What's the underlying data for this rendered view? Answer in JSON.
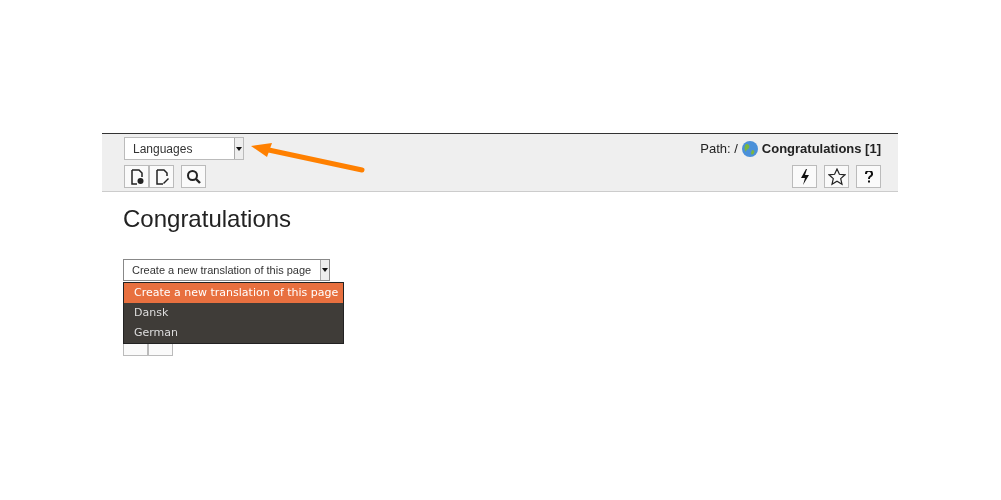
{
  "toolbar": {
    "language_select": {
      "value": "Languages"
    },
    "path": {
      "label": "Path: /",
      "page": "Congratulations [1]"
    }
  },
  "title": "Congratulations",
  "translation_select": {
    "value": "Create a new translation of this page",
    "expanded": true,
    "options": [
      {
        "label": "Create a new translation of this page",
        "selected": true
      },
      {
        "label": "Dansk",
        "selected": false
      },
      {
        "label": "German",
        "selected": false
      }
    ]
  }
}
